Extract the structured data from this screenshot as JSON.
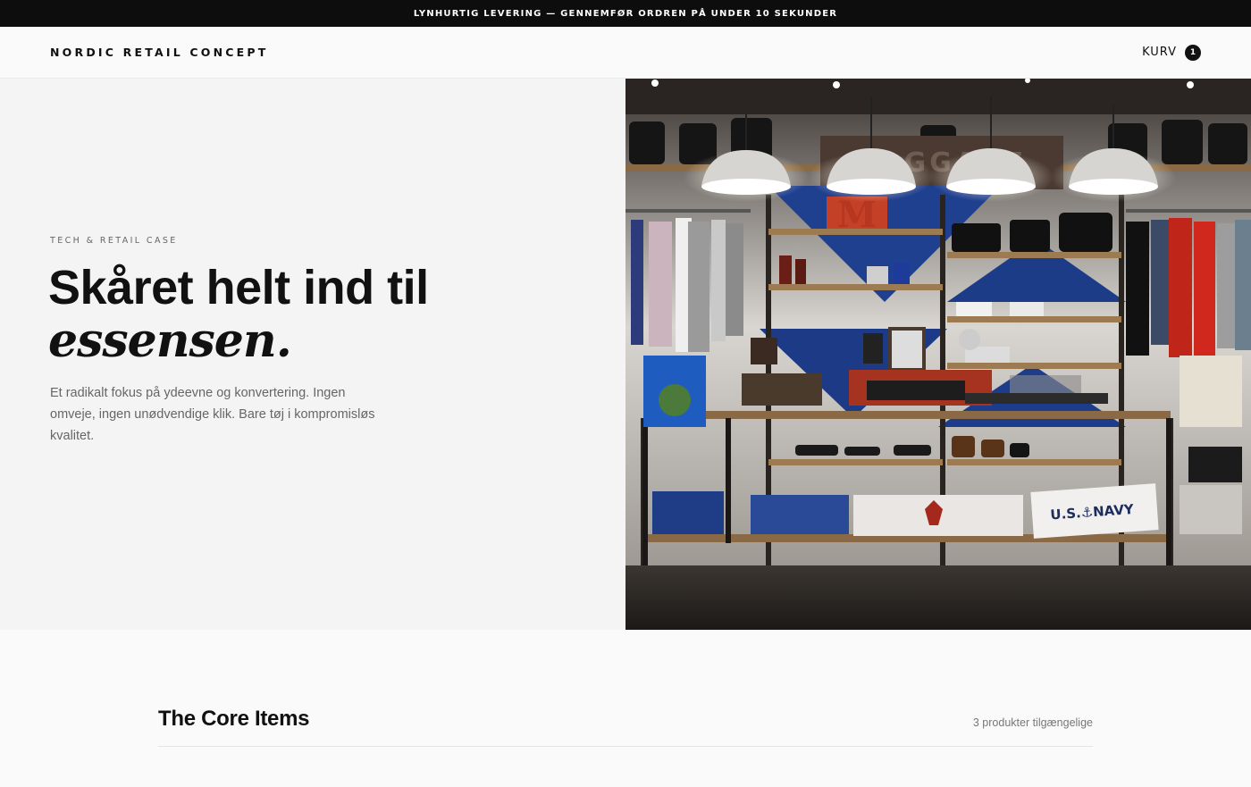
{
  "announcement": "LYNHURTIG LEVERING — GENNEMFØR ORDREN PÅ UNDER 10 SEKUNDER",
  "header": {
    "logo": "NORDIC RETAIL CONCEPT",
    "cart_label": "KURV",
    "cart_count": "1"
  },
  "hero": {
    "eyebrow": "TECH & RETAIL CASE",
    "headline_line1": "Skåret helt ind til",
    "headline_line2": "essensen.",
    "lede": "Et radikalt fokus på ydeevne og konvertering. Ingen omveje, ingen unødvendige klik. Bare tøj i kompromisløs kvalitet.",
    "image_label": "store-interior-photo",
    "sign_text": "U.S.⚓NAVY"
  },
  "core": {
    "title": "The Core Items",
    "count": "3 produkter tilgængelige"
  },
  "colors": {
    "announcement_bg": "#0d0d0d",
    "hero_left_bg": "#f4f4f4",
    "page_bg": "#fafafa",
    "accent_dark": "#111111"
  }
}
